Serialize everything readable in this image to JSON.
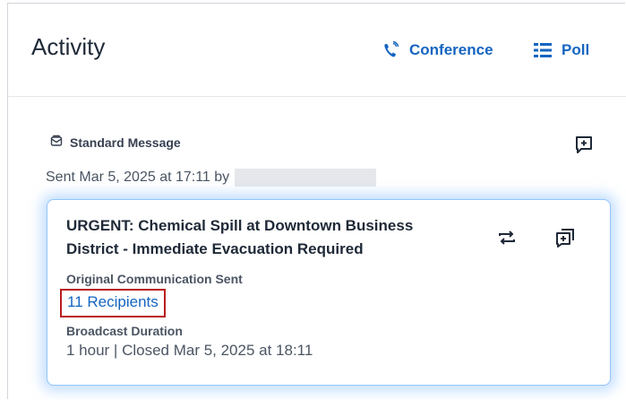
{
  "header": {
    "title": "Activity",
    "conference_label": "Conference",
    "poll_label": "Poll"
  },
  "message": {
    "type_label": "Standard Message",
    "sent_text": "Sent Mar 5, 2025 at 17:11 by"
  },
  "card": {
    "title": "URGENT: Chemical Spill at Downtown Business District - Immediate Evacuation Required",
    "original_label": "Original Communication Sent",
    "recipients_link": "11 Recipients",
    "duration_label": "Broadcast Duration",
    "duration_value": "1 hour | Closed Mar 5, 2025 at 18:11"
  },
  "colors": {
    "accent": "#1565c0",
    "highlight_border": "#b91c1c",
    "card_glow": "#93c5fd"
  },
  "icons": [
    "phone-broadcast-icon",
    "poll-icon",
    "message-type-icon",
    "add-comment-icon",
    "repost-icon",
    "copy-icon"
  ]
}
